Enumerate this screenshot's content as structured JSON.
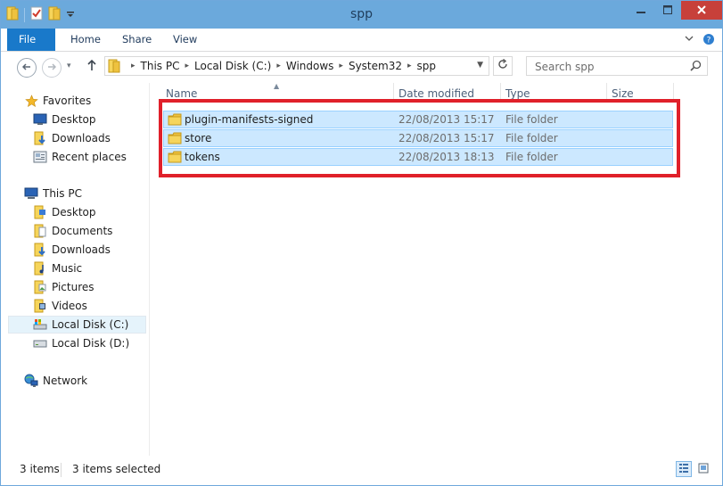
{
  "window": {
    "title": "spp"
  },
  "ribbon": {
    "tabs": [
      "File",
      "Home",
      "Share",
      "View"
    ]
  },
  "address": {
    "path": [
      "This PC",
      "Local Disk (C:)",
      "Windows",
      "System32",
      "spp"
    ]
  },
  "search": {
    "placeholder": "Search spp"
  },
  "sidebar": {
    "favorites_label": "Favorites",
    "favorites": [
      "Desktop",
      "Downloads",
      "Recent places"
    ],
    "thispc_label": "This PC",
    "thispc": [
      "Desktop",
      "Documents",
      "Downloads",
      "Music",
      "Pictures",
      "Videos",
      "Local Disk (C:)",
      "Local Disk (D:)"
    ],
    "network_label": "Network"
  },
  "columns": [
    "Name",
    "Date modified",
    "Type",
    "Size"
  ],
  "files": [
    {
      "name": "plugin-manifests-signed",
      "date": "22/08/2013 15:17",
      "type": "File folder"
    },
    {
      "name": "store",
      "date": "22/08/2013 15:17",
      "type": "File folder"
    },
    {
      "name": "tokens",
      "date": "22/08/2013 18:13",
      "type": "File folder"
    }
  ],
  "status": {
    "count": "3 items",
    "selected": "3 items selected"
  },
  "colors": {
    "titlebar": "#6ba9dc",
    "file_tab": "#1979ca",
    "selection": "#cce8ff",
    "highlight": "#e0202a",
    "close": "#c7403a"
  },
  "icons": [
    "folder-icon",
    "checklist-icon",
    "dropdown-icon",
    "minimize-icon",
    "maximize-icon",
    "close-icon",
    "back-icon",
    "forward-icon",
    "up-arrow-icon",
    "refresh-icon",
    "search-icon",
    "star-icon",
    "desktop-icon",
    "downloads-icon",
    "recent-places-icon",
    "computer-icon",
    "documents-icon",
    "music-icon",
    "pictures-icon",
    "videos-icon",
    "drive-icon",
    "network-icon",
    "details-view-icon",
    "large-icons-view-icon"
  ]
}
